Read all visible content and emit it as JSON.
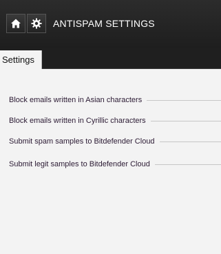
{
  "header": {
    "title": "ANTISPAM SETTINGS",
    "home_icon": "home-icon",
    "settings_icon": "gear-icon"
  },
  "tabs": [
    {
      "label": "Settings",
      "active": true
    }
  ],
  "settings": [
    {
      "label": "Block emails written in Asian characters"
    },
    {
      "label": "Block emails written in Cyrillic characters"
    },
    {
      "label": "Submit spam samples to Bitdefender Cloud"
    },
    {
      "label": "Submit legit samples to Bitdefender Cloud"
    }
  ]
}
